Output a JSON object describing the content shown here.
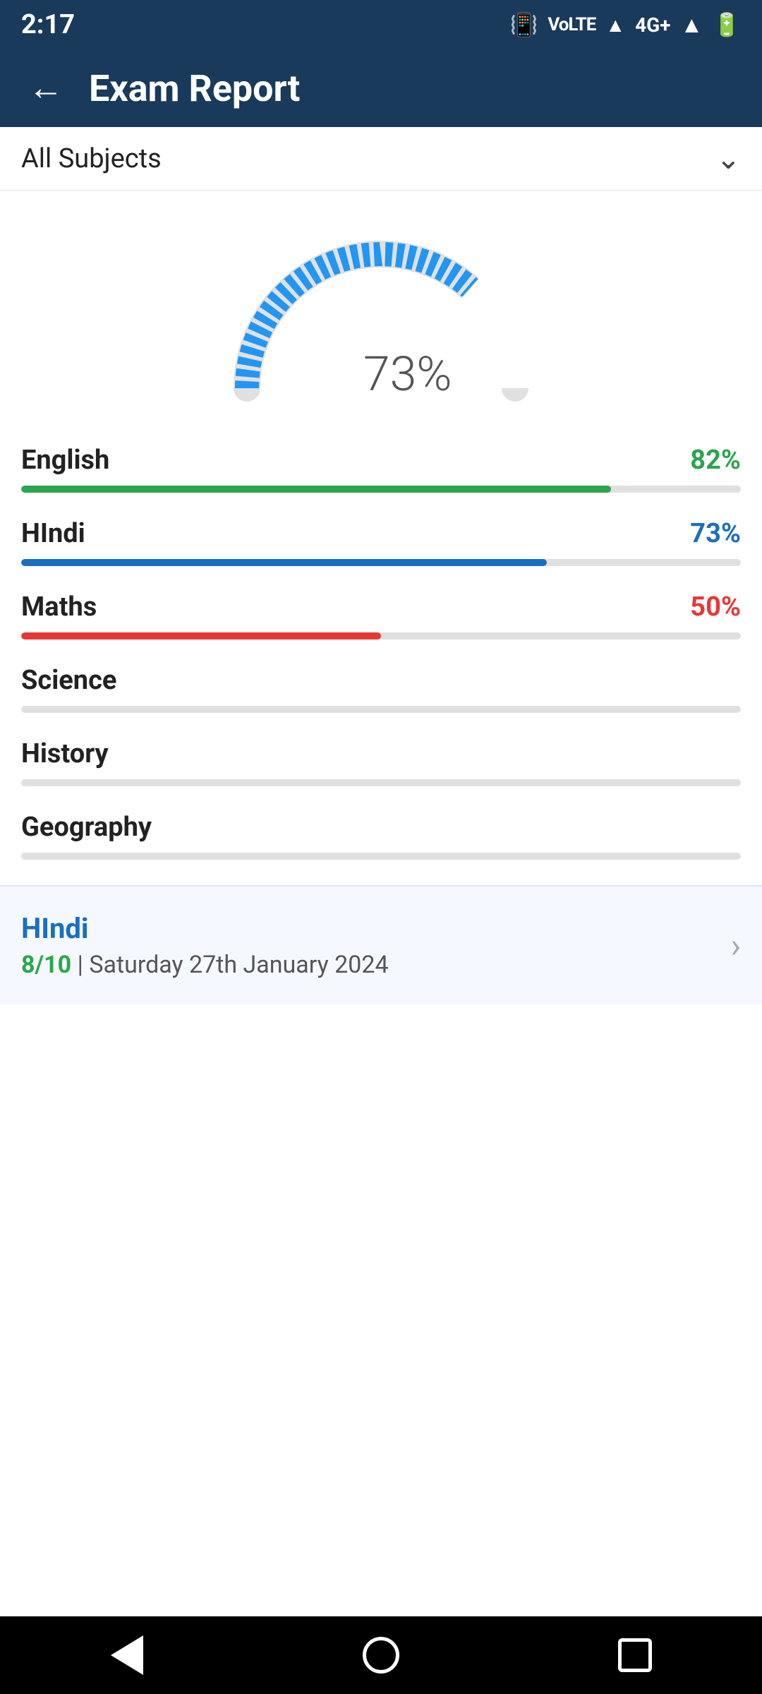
{
  "statusBar": {
    "time": "2:17",
    "icons": [
      "vibrate",
      "volte",
      "wifi",
      "4g",
      "signal",
      "battery"
    ]
  },
  "header": {
    "backLabel": "←",
    "title": "Exam Report"
  },
  "subjectDropdown": {
    "label": "All Subjects",
    "chevron": "⌄"
  },
  "gauge": {
    "percent": "73%",
    "value": 73
  },
  "subjects": [
    {
      "name": "English",
      "percent": 82,
      "percentLabel": "82%",
      "color": "#2da44e",
      "hasData": true
    },
    {
      "name": "HIndi",
      "percent": 73,
      "percentLabel": "73%",
      "color": "#1a6ec1",
      "hasData": true
    },
    {
      "name": "Maths",
      "percent": 50,
      "percentLabel": "50%",
      "color": "#e53935",
      "hasData": true
    },
    {
      "name": "Science",
      "percent": 0,
      "percentLabel": "",
      "color": "#e0e0e0",
      "hasData": false
    },
    {
      "name": "History",
      "percent": 0,
      "percentLabel": "",
      "color": "#e0e0e0",
      "hasData": false
    },
    {
      "name": "Geography",
      "percent": 0,
      "percentLabel": "",
      "color": "#e0e0e0",
      "hasData": false
    }
  ],
  "recentExam": {
    "subject": "HIndi",
    "score": "8/10",
    "separator": " | ",
    "date": "Saturday 27th January 2024"
  },
  "navBar": {
    "back": "back",
    "home": "home",
    "recent": "recent"
  }
}
